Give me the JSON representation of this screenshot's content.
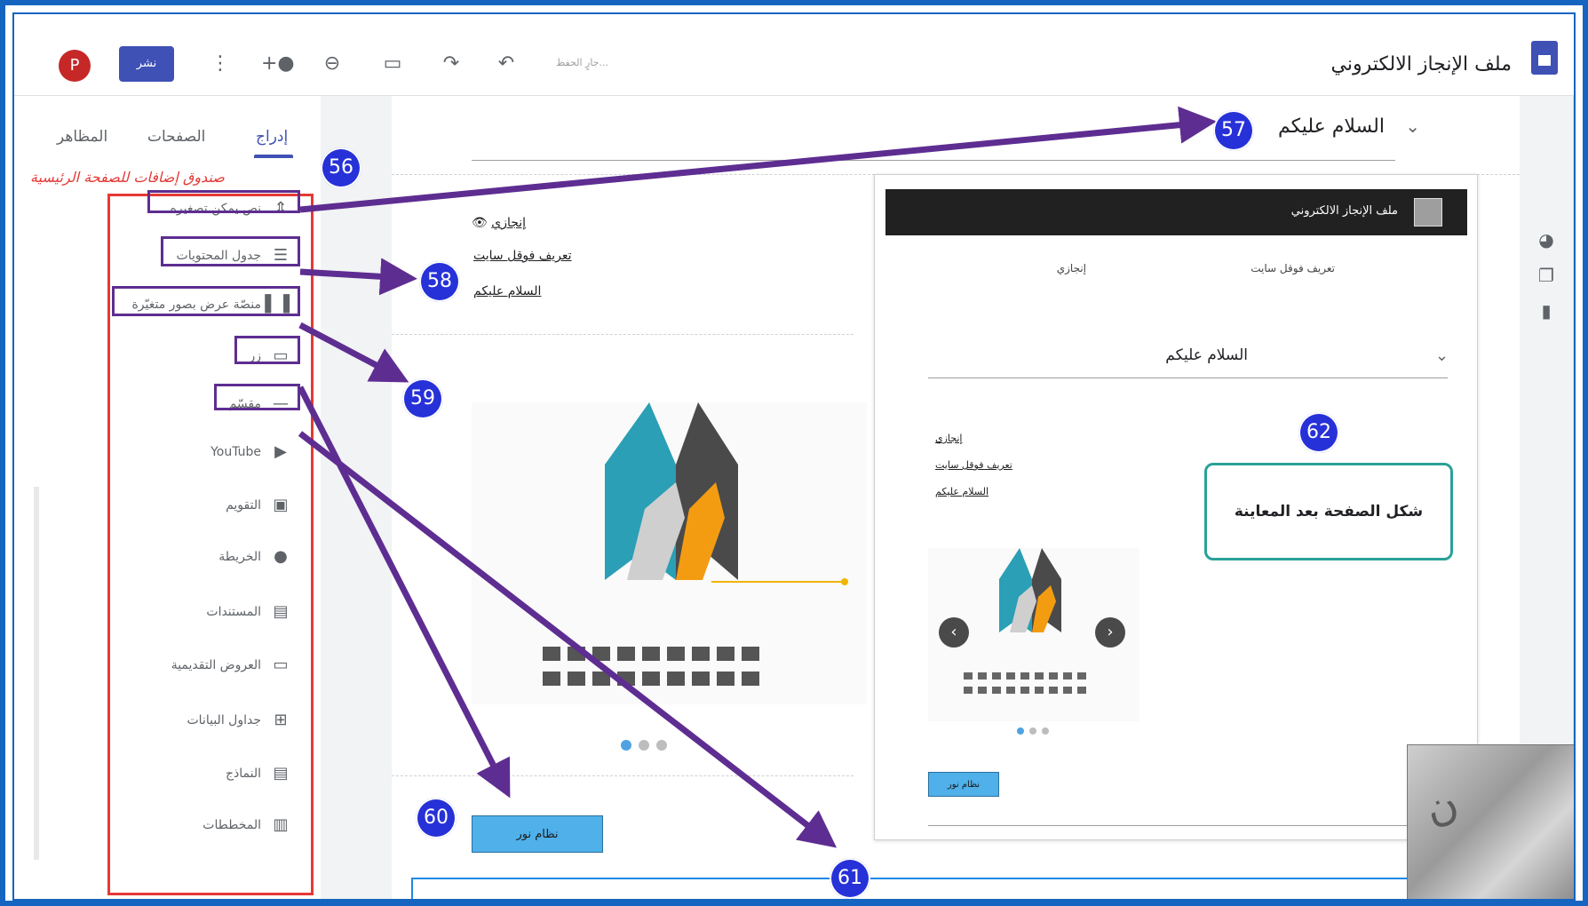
{
  "topbar": {
    "site_title": "ملف الإنجاز الالكتروني",
    "saving_status": "جارٍ الحفظ...",
    "publish_label": "نشر",
    "avatar_letter": "P"
  },
  "sidebar": {
    "tabs": [
      "إدراج",
      "الصفحات",
      "المظاهر"
    ],
    "caption": "صندوق إضافات للصفحة الرئيسية",
    "items": [
      {
        "label": "نص يمكن تصغيره",
        "icon": "collapsible-icon"
      },
      {
        "label": "جدول المحتويات",
        "icon": "toc-icon"
      },
      {
        "label": "منصّة عرض بصور متغيّرة",
        "icon": "carousel-icon"
      },
      {
        "label": "زر",
        "icon": "button-icon"
      },
      {
        "label": "مقسّم",
        "icon": "divider-icon"
      },
      {
        "label": "YouTube",
        "icon": "youtube-icon"
      },
      {
        "label": "التقويم",
        "icon": "calendar-icon"
      },
      {
        "label": "الخريطة",
        "icon": "map-pin-icon"
      },
      {
        "label": "المستندات",
        "icon": "docs-icon"
      },
      {
        "label": "العروض التقديمية",
        "icon": "slides-icon"
      },
      {
        "label": "جداول البيانات",
        "icon": "sheets-icon"
      },
      {
        "label": "النماذج",
        "icon": "forms-icon"
      },
      {
        "label": "المخططات",
        "icon": "charts-icon"
      }
    ]
  },
  "editor": {
    "heading": "السلام عليكم",
    "toc": [
      "إنجازي",
      "تعريف فوقل سايت",
      "السلام عليكم"
    ],
    "button_label": "نظام نور"
  },
  "preview": {
    "title": "ملف الإنجاز الالكتروني",
    "nav": [
      "تعريف فوقل سايت",
      "إنجازي"
    ],
    "heading": "السلام عليكم",
    "links": [
      "إنجازي",
      "تعريف فوقل سايت",
      "السلام عليكم"
    ],
    "button_label": "نظام نور"
  },
  "callout": "شكل الصفحة بعد المعاينة",
  "badges": [
    "56",
    "57",
    "58",
    "59",
    "60",
    "61",
    "62"
  ],
  "colors": {
    "accent": "#3f51b5",
    "annotation_purple": "#5e2d91",
    "badge_blue": "#2731d8",
    "highlight_red": "#e53935",
    "callout_teal": "#2aa198",
    "button_blue": "#4fb0ea"
  }
}
